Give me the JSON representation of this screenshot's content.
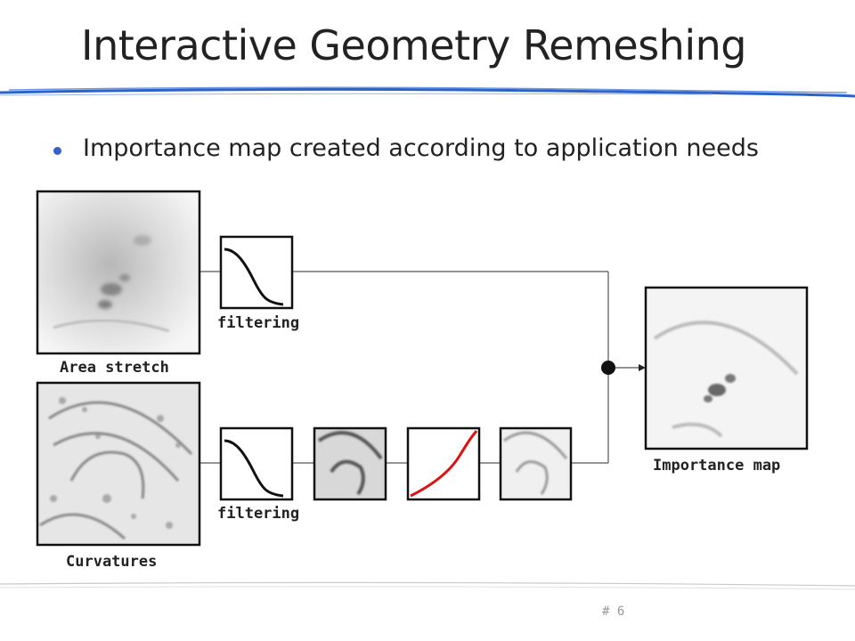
{
  "slide": {
    "title": "Interactive Geometry Remeshing",
    "bullet": "Importance map created according to application needs",
    "page_number": "# 6"
  },
  "diagram": {
    "labels": {
      "area_stretch": "Area stretch",
      "curvatures": "Curvatures",
      "filtering_top": "filtering",
      "filtering_bottom": "filtering",
      "importance_map": "Importance map"
    },
    "colors": {
      "accent_blue": "#3a6fd8",
      "curve_black": "#111111",
      "curve_red": "#e01010",
      "line": "#555555"
    }
  }
}
